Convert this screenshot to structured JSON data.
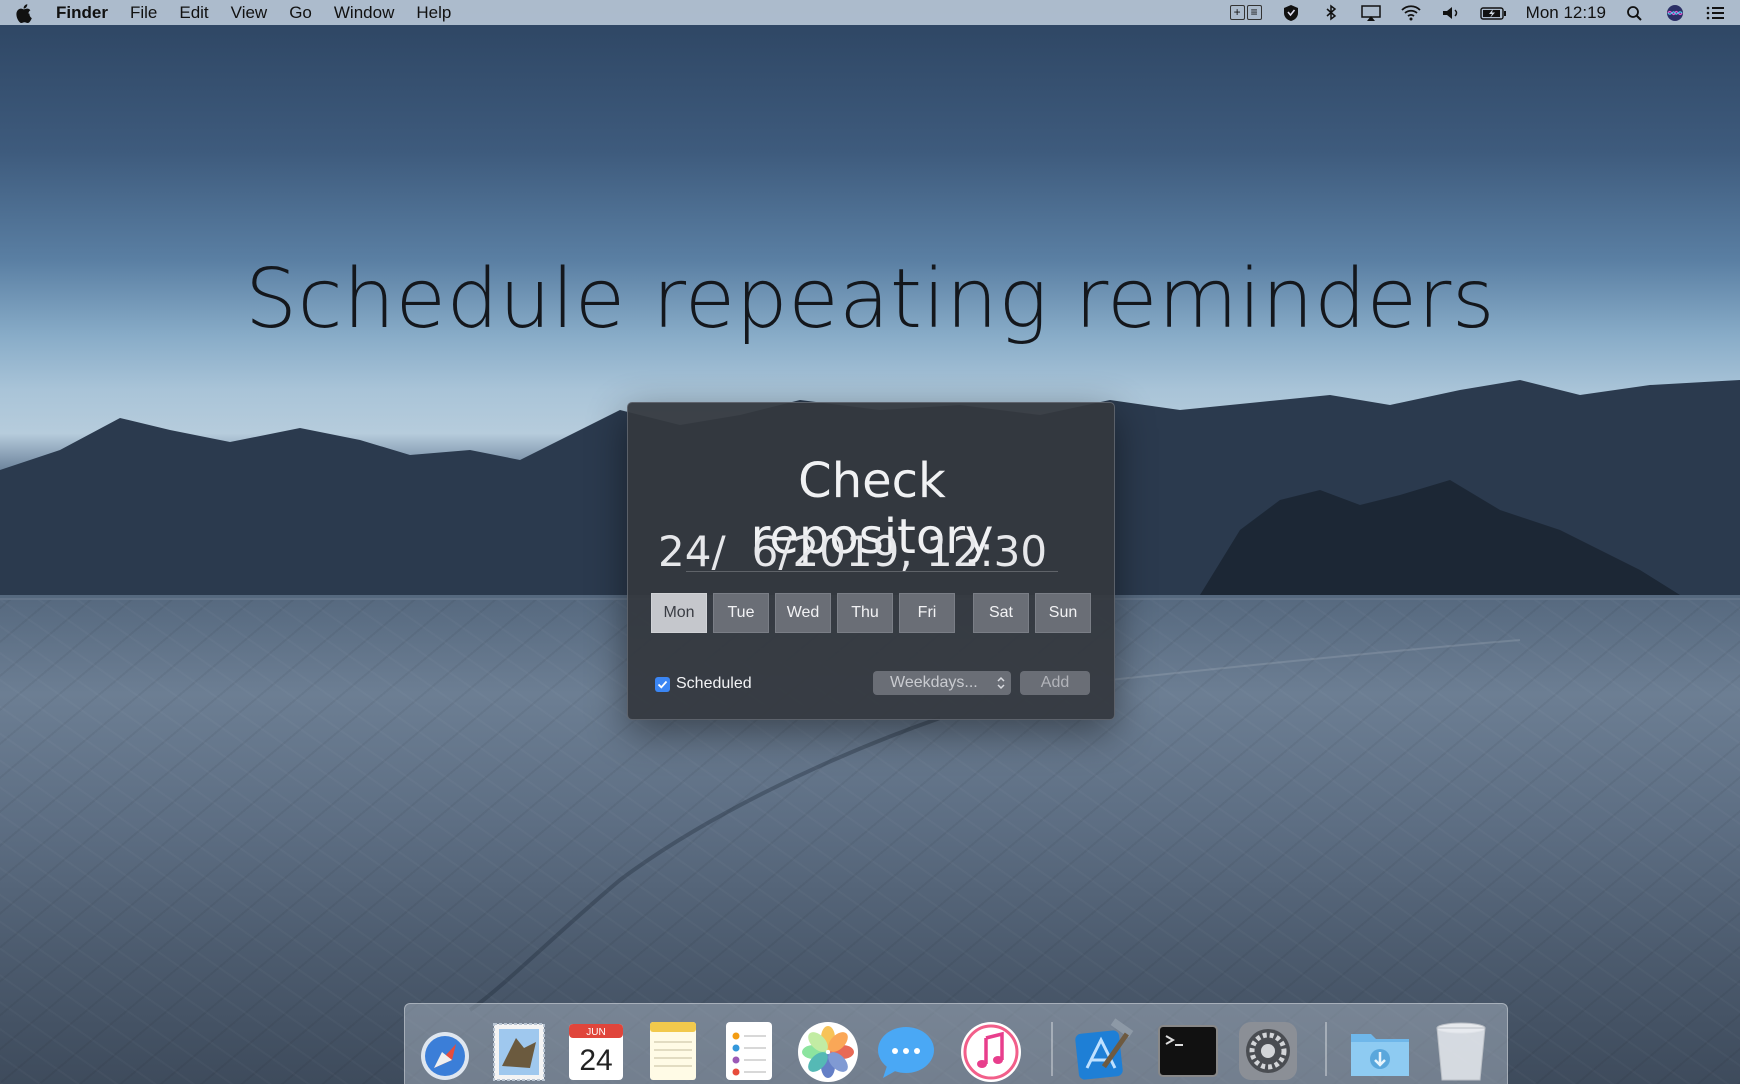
{
  "menubar": {
    "app_name": "Finder",
    "menus": [
      "File",
      "Edit",
      "View",
      "Go",
      "Window",
      "Help"
    ],
    "clock": "Mon 12:19",
    "status_icons": [
      "split-view-icon",
      "shield-icon",
      "bluetooth-icon",
      "airplay-icon",
      "wifi-icon",
      "volume-icon",
      "battery-icon",
      "search-icon",
      "siri-icon",
      "notification-center-icon"
    ]
  },
  "headline": "Schedule repeating reminders",
  "popup": {
    "title": "Check repository",
    "date_day": "24/",
    "date_rest": "6/2019, 12:30",
    "days": [
      {
        "label": "Mon",
        "selected": true
      },
      {
        "label": "Tue",
        "selected": false
      },
      {
        "label": "Wed",
        "selected": false
      },
      {
        "label": "Thu",
        "selected": false
      },
      {
        "label": "Fri",
        "selected": false
      },
      {
        "label": "Sat",
        "selected": false
      },
      {
        "label": "Sun",
        "selected": false
      }
    ],
    "scheduled_label": "Scheduled",
    "scheduled_checked": true,
    "repeat_select": "Weekdays...",
    "add_label": "Add"
  },
  "dock": {
    "calendar_month": "JUN",
    "calendar_day": "24",
    "apps": [
      "finder-icon",
      "mail-icon",
      "calendar-icon",
      "notes-icon",
      "reminders-icon",
      "photos-icon",
      "messages-icon",
      "itunes-icon",
      "xcode-icon",
      "terminal-icon",
      "system-preferences-icon",
      "downloads-folder-icon",
      "trash-icon"
    ]
  },
  "colors": {
    "checkbox_blue": "#3b86f4",
    "popup_bg": "#34383f",
    "day_selected": "#c5c7cc",
    "day_default": "#6a6e76"
  }
}
